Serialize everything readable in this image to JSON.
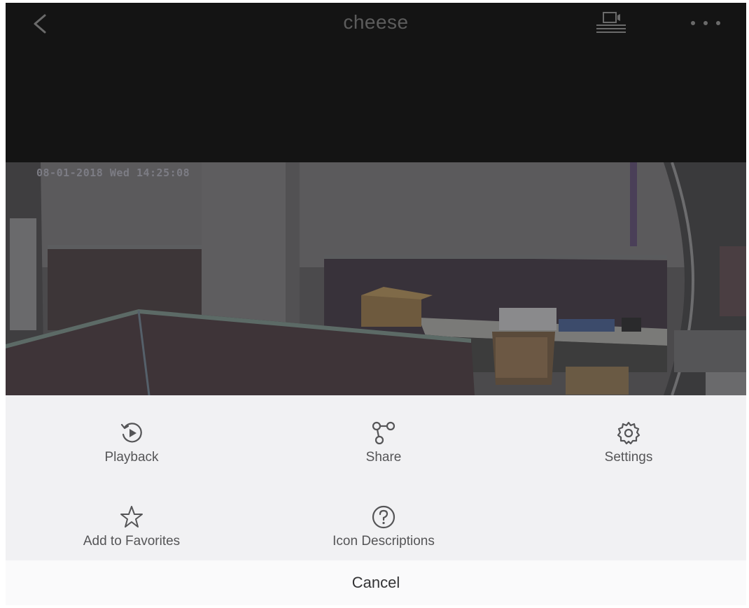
{
  "header": {
    "title": "cheese",
    "back_icon": "chevron-left-icon",
    "cast_icon": "screen-cast-icon",
    "more_icon": "more-horizontal-icon"
  },
  "video": {
    "overlay_timestamp": "08-01-2018 Wed 14:25:08"
  },
  "action_sheet": {
    "actions": [
      {
        "label": "Playback",
        "icon": "playback-icon"
      },
      {
        "label": "Share",
        "icon": "share-icon"
      },
      {
        "label": "Settings",
        "icon": "gear-icon"
      },
      {
        "label": "Add to Favorites",
        "icon": "star-icon"
      },
      {
        "label": "Icon Descriptions",
        "icon": "help-circle-icon"
      }
    ],
    "cancel_label": "Cancel"
  },
  "colors": {
    "background_dark": "#141414",
    "sheet_background": "#f1f1f3",
    "icon_color": "#555557"
  }
}
